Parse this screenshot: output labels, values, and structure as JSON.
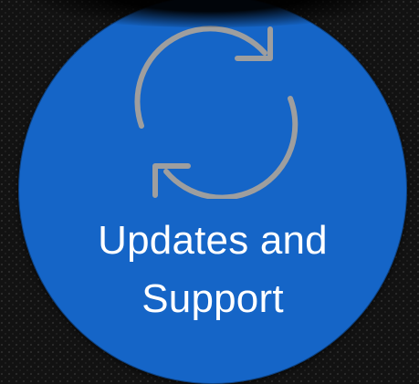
{
  "tile": {
    "title_line1": "Updates and",
    "title_line2": "Support",
    "icon": "refresh-icon",
    "background_color": "#1565c7",
    "icon_color": "#9e9e9e"
  }
}
